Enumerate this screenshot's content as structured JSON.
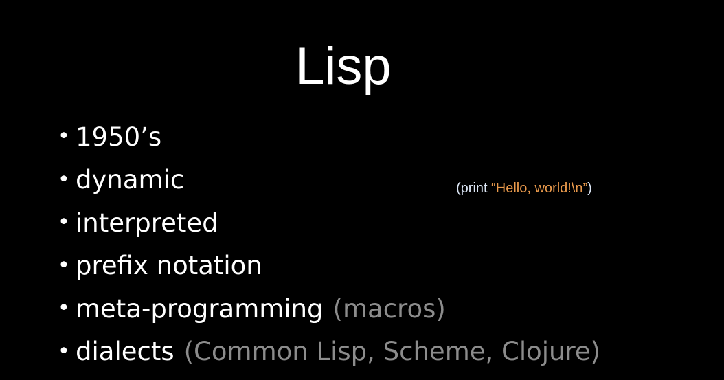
{
  "slide": {
    "title": "Lisp",
    "bullets": [
      {
        "text": "1950’s",
        "aside": ""
      },
      {
        "text": "dynamic",
        "aside": ""
      },
      {
        "text": "interpreted",
        "aside": ""
      },
      {
        "text": "prefix notation",
        "aside": ""
      },
      {
        "text": "meta-programming",
        "aside": "(macros)"
      },
      {
        "text": "dialects",
        "aside": "(Common Lisp, Scheme, Clojure)"
      }
    ],
    "bullet_glyph": "•",
    "code_example": {
      "open": "(print ",
      "string": "“Hello, world!\\n”",
      "close": ")"
    }
  },
  "colors": {
    "background": "#000000",
    "text": "#ffffff",
    "muted": "#8c8c8c",
    "code_text": "#dce6f5",
    "code_string": "#ea9a4c"
  }
}
